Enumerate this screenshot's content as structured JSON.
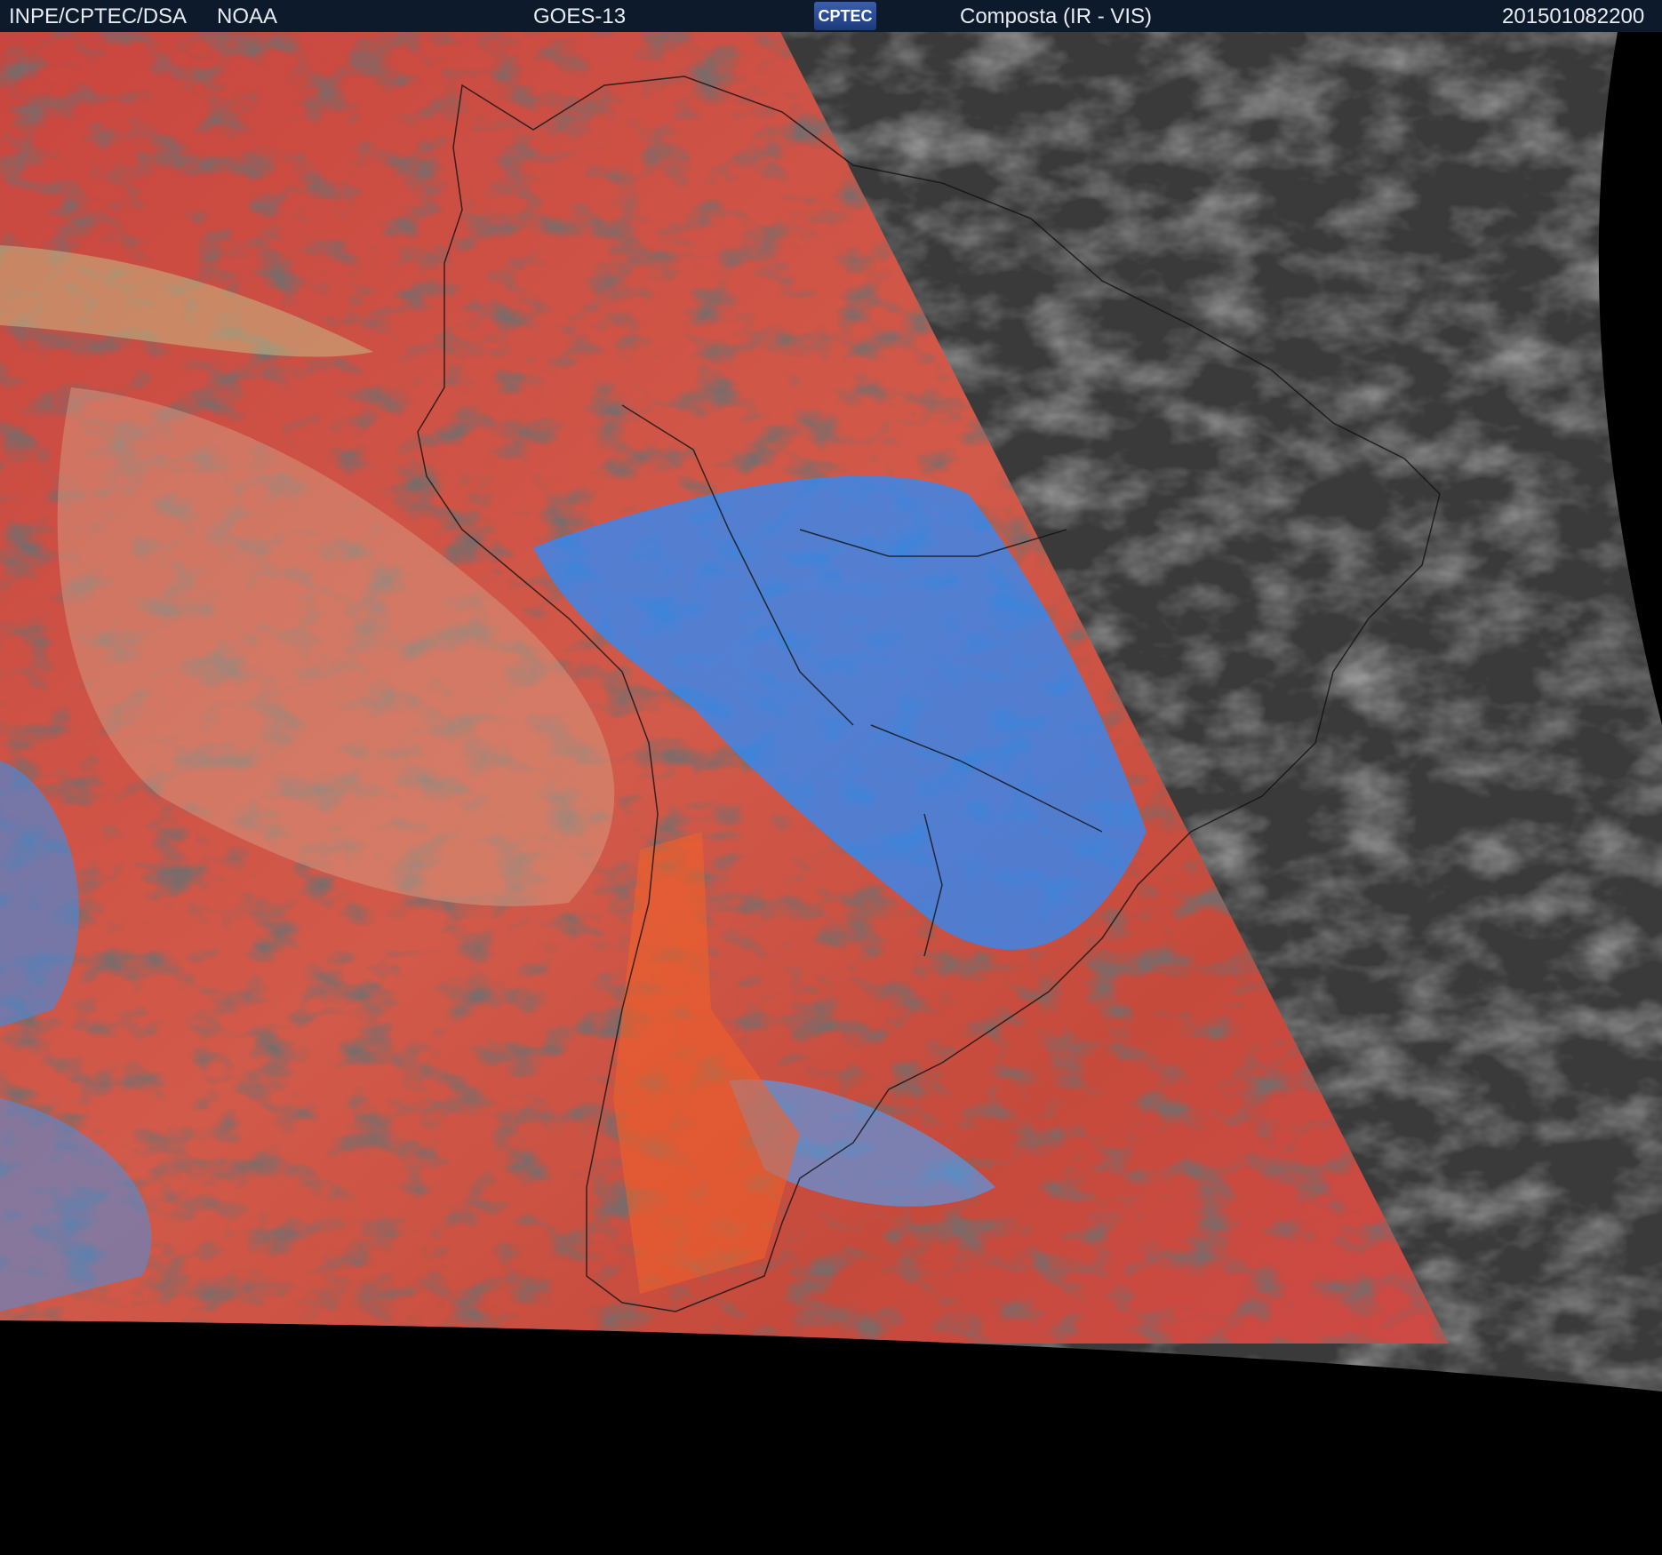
{
  "header": {
    "agency": "INPE/CPTEC/DSA",
    "partner": "NOAA",
    "satellite": "GOES-13",
    "logo_text": "CPTEC",
    "product": "Composta (IR - VIS)",
    "timestamp": "201501082200"
  },
  "colors": {
    "header_bg": "#0c1a2c",
    "ir_red": "#c9463f",
    "ir_blue": "#2a8cff",
    "vis_gray": "#3a3a3a",
    "space": "#000000"
  }
}
